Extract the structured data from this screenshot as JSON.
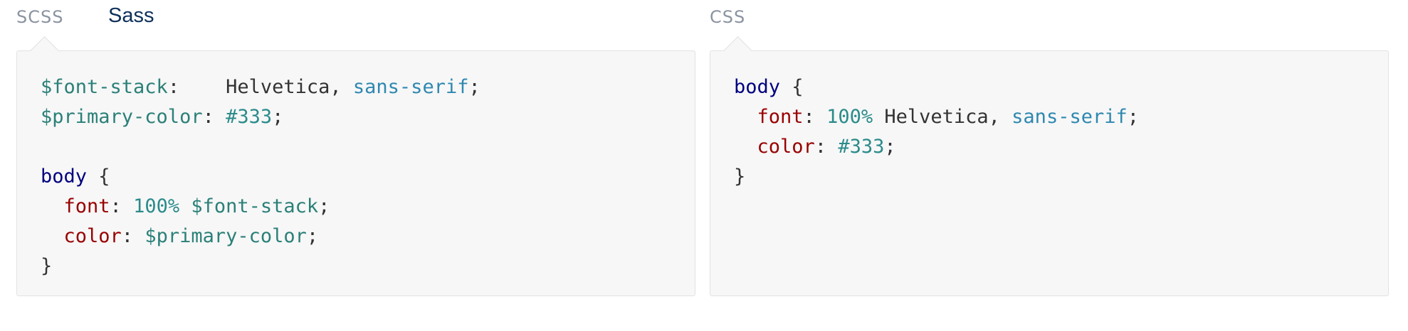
{
  "left_panel": {
    "tabs": [
      {
        "label": "SCSS",
        "active": false
      },
      {
        "label": "Sass",
        "active": true
      }
    ],
    "code_lines": [
      [
        {
          "t": "$font-stack",
          "c": "var"
        },
        {
          "t": ":    ",
          "c": "plain"
        },
        {
          "t": "Helvetica, ",
          "c": "plain"
        },
        {
          "t": "sans-serif",
          "c": "str"
        },
        {
          "t": ";",
          "c": "plain"
        }
      ],
      [
        {
          "t": "$primary-color",
          "c": "var"
        },
        {
          "t": ": ",
          "c": "plain"
        },
        {
          "t": "#333",
          "c": "num"
        },
        {
          "t": ";",
          "c": "plain"
        }
      ],
      [],
      [
        {
          "t": "body",
          "c": "sel"
        },
        {
          "t": " {",
          "c": "plain"
        }
      ],
      [
        {
          "t": "  ",
          "c": "plain"
        },
        {
          "t": "font",
          "c": "prop"
        },
        {
          "t": ": ",
          "c": "plain"
        },
        {
          "t": "100%",
          "c": "num"
        },
        {
          "t": " ",
          "c": "plain"
        },
        {
          "t": "$font-stack",
          "c": "var"
        },
        {
          "t": ";",
          "c": "plain"
        }
      ],
      [
        {
          "t": "  ",
          "c": "plain"
        },
        {
          "t": "color",
          "c": "prop"
        },
        {
          "t": ": ",
          "c": "plain"
        },
        {
          "t": "$primary-color",
          "c": "var"
        },
        {
          "t": ";",
          "c": "plain"
        }
      ],
      [
        {
          "t": "}",
          "c": "plain"
        }
      ]
    ]
  },
  "right_panel": {
    "tabs": [
      {
        "label": "CSS",
        "active": false
      }
    ],
    "code_lines": [
      [
        {
          "t": "body",
          "c": "sel"
        },
        {
          "t": " {",
          "c": "plain"
        }
      ],
      [
        {
          "t": "  ",
          "c": "plain"
        },
        {
          "t": "font",
          "c": "prop"
        },
        {
          "t": ": ",
          "c": "plain"
        },
        {
          "t": "100%",
          "c": "num"
        },
        {
          "t": " Helvetica, ",
          "c": "plain"
        },
        {
          "t": "sans-serif",
          "c": "str"
        },
        {
          "t": ";",
          "c": "plain"
        }
      ],
      [
        {
          "t": "  ",
          "c": "plain"
        },
        {
          "t": "color",
          "c": "prop"
        },
        {
          "t": ": ",
          "c": "plain"
        },
        {
          "t": "#333",
          "c": "num"
        },
        {
          "t": ";",
          "c": "plain"
        }
      ],
      [
        {
          "t": "}",
          "c": "plain"
        }
      ]
    ]
  },
  "colors": {
    "variable": "#2b8078",
    "string": "#2f88b0",
    "number": "#2b8b8b",
    "selector": "#000080",
    "property": "#990000",
    "text": "#333333",
    "code_background": "#f7f7f7",
    "tab_active": "#0e2f5a",
    "tab_inactive": "#8a93a0"
  }
}
